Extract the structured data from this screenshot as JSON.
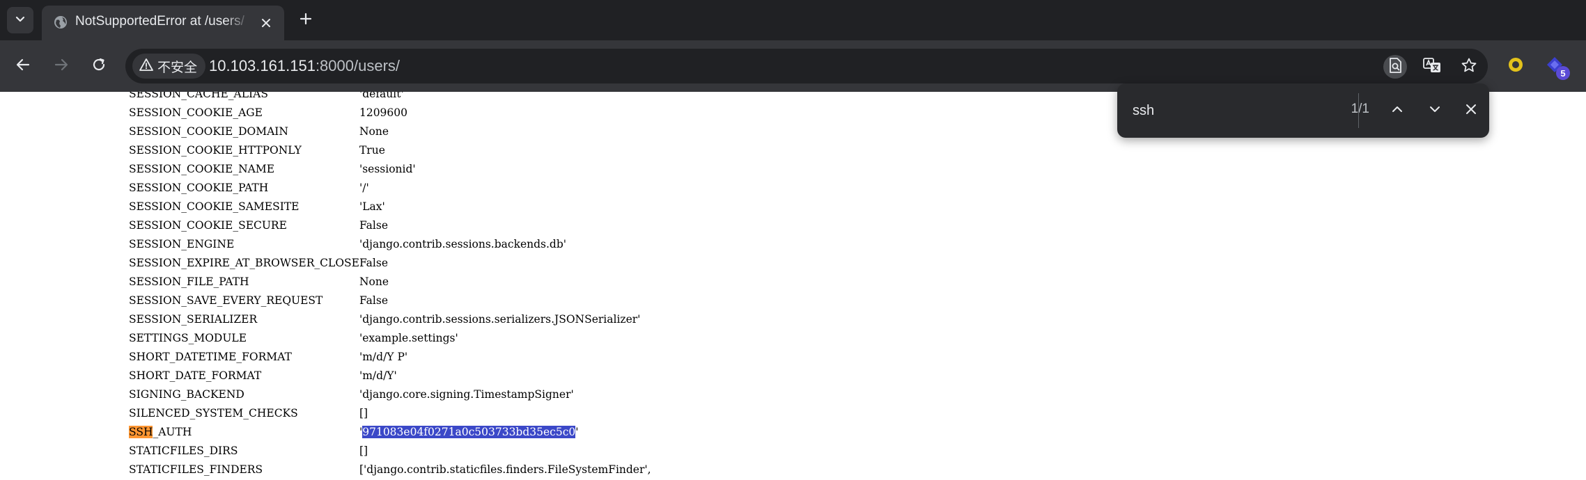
{
  "browser": {
    "tab": {
      "title": "NotSupportedError at /users/"
    },
    "omnibox": {
      "security_label": "不安全",
      "url_host": "10.103.161.151",
      "url_rest": ":8000/users/"
    },
    "extensions": {
      "badge_count": "5"
    }
  },
  "find_bar": {
    "query": "ssh",
    "match_count": "1/1"
  },
  "settings": [
    {
      "key": "SESSION_CACHE_ALIAS",
      "value": "'default'"
    },
    {
      "key": "SESSION_COOKIE_AGE",
      "value": "1209600"
    },
    {
      "key": "SESSION_COOKIE_DOMAIN",
      "value": "None"
    },
    {
      "key": "SESSION_COOKIE_HTTPONLY",
      "value": "True"
    },
    {
      "key": "SESSION_COOKIE_NAME",
      "value": "'sessionid'"
    },
    {
      "key": "SESSION_COOKIE_PATH",
      "value": "'/'"
    },
    {
      "key": "SESSION_COOKIE_SAMESITE",
      "value": "'Lax'"
    },
    {
      "key": "SESSION_COOKIE_SECURE",
      "value": "False"
    },
    {
      "key": "SESSION_ENGINE",
      "value": "'django.contrib.sessions.backends.db'"
    },
    {
      "key": "SESSION_EXPIRE_AT_BROWSER_CLOSE",
      "value": "False"
    },
    {
      "key": "SESSION_FILE_PATH",
      "value": "None"
    },
    {
      "key": "SESSION_SAVE_EVERY_REQUEST",
      "value": "False"
    },
    {
      "key": "SESSION_SERIALIZER",
      "value": "'django.contrib.sessions.serializers.JSONSerializer'"
    },
    {
      "key": "SETTINGS_MODULE",
      "value": "'example.settings'"
    },
    {
      "key": "SHORT_DATETIME_FORMAT",
      "value": "'m/d/Y P'"
    },
    {
      "key": "SHORT_DATE_FORMAT",
      "value": "'m/d/Y'"
    },
    {
      "key": "SIGNING_BACKEND",
      "value": "'django.core.signing.TimestampSigner'"
    },
    {
      "key": "SILENCED_SYSTEM_CHECKS",
      "value": "[]"
    },
    {
      "key_match": "SSH",
      "key_rest": "_AUTH",
      "value_open": "'",
      "value_selected": "971083e04f0271a0c503733bd35ec5c0",
      "value_close": "'"
    },
    {
      "key": "STATICFILES_DIRS",
      "value": "[]"
    },
    {
      "key": "STATICFILES_FINDERS",
      "value": "['django.contrib.staticfiles.finders.FileSystemFinder',"
    }
  ],
  "colors": {
    "find_match_highlight": "#ff9632",
    "selection_highlight": "#3b48c8"
  }
}
